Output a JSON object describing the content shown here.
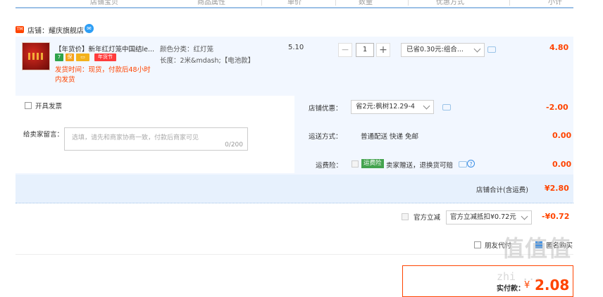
{
  "header": {
    "columns": [
      "店铺宝贝",
      "商品属性",
      "单价",
      "数量",
      "优惠方式",
      "小计"
    ]
  },
  "shop": {
    "icon": "shop-icon",
    "name": "店铺：耀庆旗舰店",
    "chat_icon": "wangwang-chat-icon"
  },
  "item": {
    "title": "【年货价】新年红灯笼中国结le...",
    "badge_year": "年货节",
    "delivery": "发货时间：现货，付款后48小时内发货",
    "attr_color": "颜色分类：红灯笼",
    "attr_length": "长度：2米&mdash;【电池款】",
    "unit_price": "5.10",
    "quantity": "1",
    "minus": "−",
    "plus": "+",
    "promo": "已省0.30元:组合...",
    "subtotal": "4.80"
  },
  "order_options": {
    "invoice_label": "开具发票",
    "message_label": "给卖家留言：",
    "message_placeholder": "选填，请先和商家协商一致，付款后商家可见",
    "message_counter": "0/200",
    "shop_discount_label": "店铺优惠：",
    "shop_discount_value": "省2元:枫树12.29-4",
    "shop_discount_amount": "-2.00",
    "shipping_label": "运送方式：",
    "shipping_value": "普通配送 快递 免邮",
    "shipping_amount": "0.00",
    "insurance_label": "运费险：",
    "insurance_tag": "运费险",
    "insurance_text": "卖家赠送，退换货可赔",
    "insurance_amount": "0.00",
    "shop_total_label": "店铺合计(含运费)",
    "shop_total_value": "¥2.80"
  },
  "official": {
    "label": "官方立减",
    "select_value": "官方立减抵扣¥0.72元",
    "amount": "-¥0.72"
  },
  "extras": {
    "friend_pay_label": "朋友代付",
    "anonymous_label": "匿名购买"
  },
  "payment": {
    "label": "实付款：",
    "currency": "¥",
    "amount": "2.08"
  },
  "watermark": {
    "cn": "值值值",
    "en": "zhi  ..."
  },
  "colors": {
    "accent": "#ff4400",
    "border_blue": "#9bc0e6",
    "row_bg": "#f2f7ff",
    "total_bg": "#e7f1fd",
    "insurance_green": "#44a34e"
  }
}
